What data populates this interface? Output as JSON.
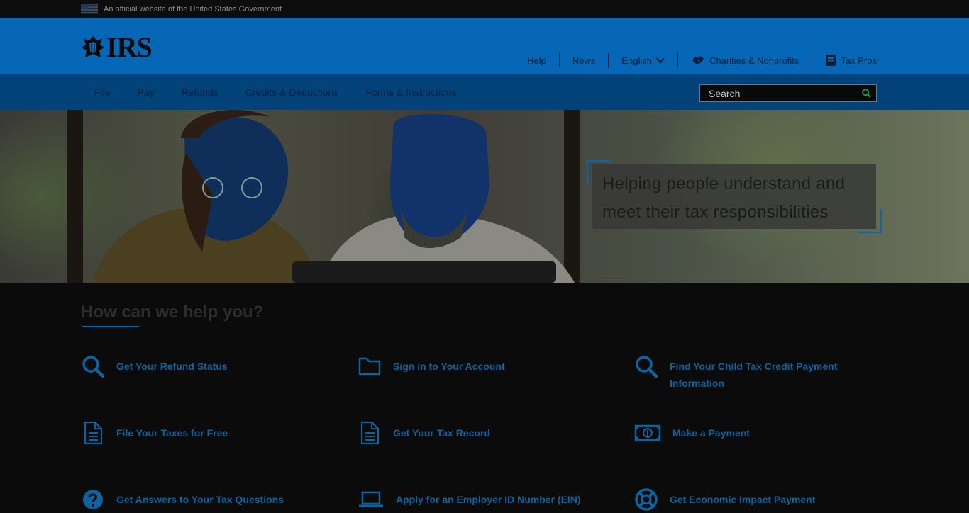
{
  "gov_banner": {
    "text": "An official website of the United States Government"
  },
  "header": {
    "logo_text": "IRS",
    "utility": [
      {
        "label": "Help"
      },
      {
        "label": "News"
      },
      {
        "label": "English"
      },
      {
        "label": "Charities & Nonprofits"
      },
      {
        "label": "Tax Pros"
      }
    ]
  },
  "nav": {
    "items": [
      {
        "label": "File"
      },
      {
        "label": "Pay"
      },
      {
        "label": "Refunds"
      },
      {
        "label": "Credits & Deductions"
      },
      {
        "label": "Forms & Instructions"
      }
    ],
    "search_placeholder": "Search"
  },
  "hero": {
    "caption_line1": "Helping people understand and",
    "caption_line2": "meet their tax responsibilities"
  },
  "help": {
    "title": "How can we help you?",
    "tasks": [
      {
        "label_line1": "Get Your Refund Status",
        "label_line2": "",
        "icon": "search-icon"
      },
      {
        "label_line1": "Sign in to Your Account",
        "label_line2": "",
        "icon": "folder-icon"
      },
      {
        "label_line1": "Find Your Child Tax Credit Payment",
        "label_line2": "Information",
        "icon": "search-icon"
      },
      {
        "label_line1": "File Your Taxes for Free",
        "label_line2": "",
        "icon": "document-icon"
      },
      {
        "label_line1": "Get Your Tax Record",
        "label_line2": "",
        "icon": "document-icon"
      },
      {
        "label_line1": "Make a Payment",
        "label_line2": "",
        "icon": "money-icon"
      },
      {
        "label_line1": "Get Answers to Your Tax Questions",
        "label_line2": "",
        "icon": "question-icon"
      },
      {
        "label_line1": "Apply for an Employer ID Number (EIN)",
        "label_line2": "",
        "icon": "laptop-icon"
      },
      {
        "label_line1": "Get Economic Impact Payment",
        "label_line2": "",
        "icon": "lifebuoy-icon"
      }
    ]
  },
  "colors": {
    "header_blue": "#0567b6",
    "nav_blue": "#04427a",
    "link_blue": "#10629f"
  }
}
